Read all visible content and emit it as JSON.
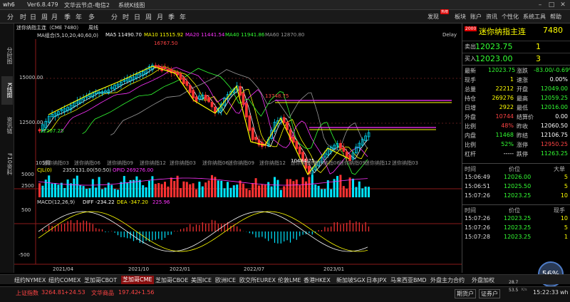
{
  "titlebar": {
    "app": "wh6",
    "version": "Ver6.8.479",
    "node": "文华云节点-电信2",
    "view": "系统K线图"
  },
  "toolbar": {
    "periods": [
      "分",
      "时",
      "日",
      "周",
      "月",
      "季",
      "年",
      "多",
      "分",
      "时",
      "日",
      "周",
      "月",
      "季",
      "年"
    ],
    "right": [
      "发现",
      "板块",
      "账户",
      "资讯",
      "个性化",
      "系统工具",
      "帮助"
    ],
    "hot_badge": "热榜"
  },
  "sidebar": [
    "分时图",
    "K线图",
    "资讯链",
    "F10资料"
  ],
  "chart": {
    "title": "迷你纳指主连（CME 7480）",
    "period": "周线",
    "ma_label": "MA组合(5,10,20,40,60,0)",
    "ma": [
      {
        "label": "MA5 11490.70",
        "color": "#ffffff"
      },
      {
        "label": "MA10 11515.92",
        "color": "#ffff00"
      },
      {
        "label": "MA20 11441.54",
        "color": "#ff33ff"
      },
      {
        "label": "MA40 11941.86",
        "color": "#33ff33"
      },
      {
        "label": "MA60 12870.80",
        "color": "#9a9a9a"
      }
    ],
    "delay": "Delay",
    "y_labels": [
      "15000.00",
      "12500.00"
    ],
    "annotations": {
      "high": "16767.50",
      "mid_high": "13748.75",
      "left_low": "12207.25",
      "low": "10484.75"
    },
    "contracts": [
      "迷你纳指03",
      "迷你纳指06",
      "迷你纳指09",
      "迷你纳指12",
      "迷你纳指03",
      "迷你纳指06",
      "迷你纳指09",
      "迷你纳指12",
      "迷你纳指03",
      "迷你纳指06",
      "迷你纳指09",
      "迷你纳指12",
      "迷你纳指03"
    ],
    "count": "105周",
    "volume": {
      "label": "CJL(0)",
      "values": "2355131.00(50:50)",
      "opid": "OPID 269276.00",
      "y1": "5000",
      "y2": "2500"
    },
    "macd": {
      "label": "MACD(12,26,9)",
      "diff": "DIFF -234.22",
      "dea": "DEA -347.20",
      "val": "225.96",
      "y1": "500",
      "y2": "-500"
    },
    "x_labels": [
      "2021/04",
      "2021/10",
      "2022/01",
      "2022/07",
      "2023/01"
    ]
  },
  "panel": {
    "code": "2000",
    "name": "迷你纳指主连",
    "num": "7480",
    "sell_label": "卖出",
    "sell_price": "12023.75",
    "sell_qty": "1",
    "buy_label": "买入",
    "buy_price": "12023.00",
    "buy_qty": "3",
    "rows": [
      {
        "k1": "最新",
        "v1": "12023.75",
        "c1": "#33ff33",
        "k2": "涨跌",
        "v2": "-83.00/-0.69%",
        "c2": "#33ff33"
      },
      {
        "k1": "现手",
        "v1": "1",
        "c1": "#ffff00",
        "k2": "速涨",
        "v2": "0.00%",
        "c2": "#ffffff"
      },
      {
        "k1": "总量",
        "v1": "22212",
        "c1": "#ffff00",
        "k2": "开盘",
        "v2": "12049.00",
        "c2": "#33ff33"
      },
      {
        "k1": "持仓",
        "v1": "269276",
        "c1": "#ffff00",
        "k2": "最高",
        "v2": "12059.25",
        "c2": "#33ff33"
      },
      {
        "k1": "日增",
        "v1": "2922",
        "c1": "#ffff00",
        "k2": "最低",
        "v2": "12016.00",
        "c2": "#33ff33"
      },
      {
        "k1": "外盘",
        "v1": "10744",
        "c1": "#ff4444",
        "k2": "结算价",
        "v2": "0.00",
        "c2": "#ffffff"
      },
      {
        "k1": "比例",
        "v1": "48%",
        "c1": "#ff4444",
        "k2": "昨收",
        "v2": "12060.50",
        "c2": "#ffffff"
      },
      {
        "k1": "内盘",
        "v1": "11468",
        "c1": "#33ff33",
        "k2": "昨结",
        "v2": "12106.75",
        "c2": "#ffffff"
      },
      {
        "k1": "比例",
        "v1": "52%",
        "c1": "#33ff33",
        "k2": "涨停",
        "v2": "12950.25",
        "c2": "#ff4444"
      },
      {
        "k1": "杠杆",
        "v1": "-----",
        "c1": "#ffffff",
        "k2": "跌停",
        "v2": "11263.25",
        "c2": "#33ff33"
      }
    ],
    "ticks1_header": [
      "时间",
      "价位",
      "大单"
    ],
    "ticks1": [
      {
        "t": "15:06:49",
        "p": "12026.00",
        "v": "5"
      },
      {
        "t": "15:06:51",
        "p": "12025.50",
        "v": "5"
      },
      {
        "t": "15:07:26",
        "p": "12023.25",
        "v": "10"
      }
    ],
    "ticks2_header": [
      "时间",
      "价位",
      "现手"
    ],
    "ticks2": [
      {
        "t": "15:07:26",
        "p": "12023.25",
        "v": "10"
      },
      {
        "t": "15:07:26",
        "p": "12023.25",
        "v": "5"
      },
      {
        "t": "15:07:28",
        "p": "12023.25",
        "v": "1"
      }
    ]
  },
  "exchanges": [
    "纽约NYMEX",
    "纽约COMEX",
    "芝加哥CBOT",
    "芝加哥CME",
    "芝加哥CBOE",
    "美国ICE",
    "欧洲ICE",
    "欧交所EUREX",
    "伦敦LME",
    "香港HKEX",
    "新加坡SGX",
    "日本JPX",
    "马来西亚BMD",
    "外盘主力合约",
    "外盘加权"
  ],
  "status": {
    "index_label": "上证指数",
    "index_value": "3264.81",
    "index_change": "+24.53",
    "goods_label": "文华商品",
    "goods_value": "197.42",
    "goods_change": "+1.56",
    "buttons": [
      "期货户",
      "证券户"
    ],
    "speed1": "28.7",
    "speed2": "53.5",
    "unit": "K/s",
    "cpu": "56%",
    "clock": "15:22:33",
    "user": "wh"
  }
}
